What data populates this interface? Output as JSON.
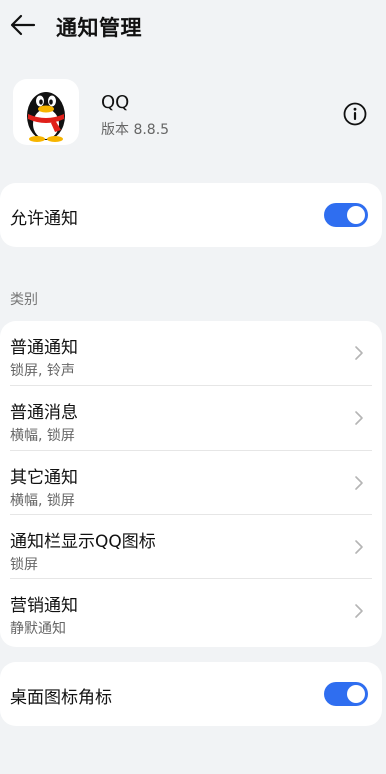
{
  "header": {
    "title": "通知管理",
    "back_icon": "arrow-left-icon"
  },
  "app": {
    "name": "QQ",
    "version": "版本 8.8.5",
    "icon": "qq-penguin-logo",
    "info_icon": "info-icon"
  },
  "allow_notifications": {
    "label": "允许通知",
    "enabled": true
  },
  "categories": {
    "section_label": "类别",
    "items": [
      {
        "title": "普通通知",
        "subtitle": "锁屏, 铃声"
      },
      {
        "title": "普通消息",
        "subtitle": "横幅, 锁屏"
      },
      {
        "title": "其它通知",
        "subtitle": "横幅, 锁屏"
      },
      {
        "title": "通知栏显示QQ图标",
        "subtitle": "锁屏"
      },
      {
        "title": "营销通知",
        "subtitle": "静默通知"
      }
    ]
  },
  "badge": {
    "label": "桌面图标角标",
    "enabled": true
  },
  "colors": {
    "accent": "#2f6ef0",
    "background": "#f1f3f5",
    "card": "#ffffff"
  }
}
